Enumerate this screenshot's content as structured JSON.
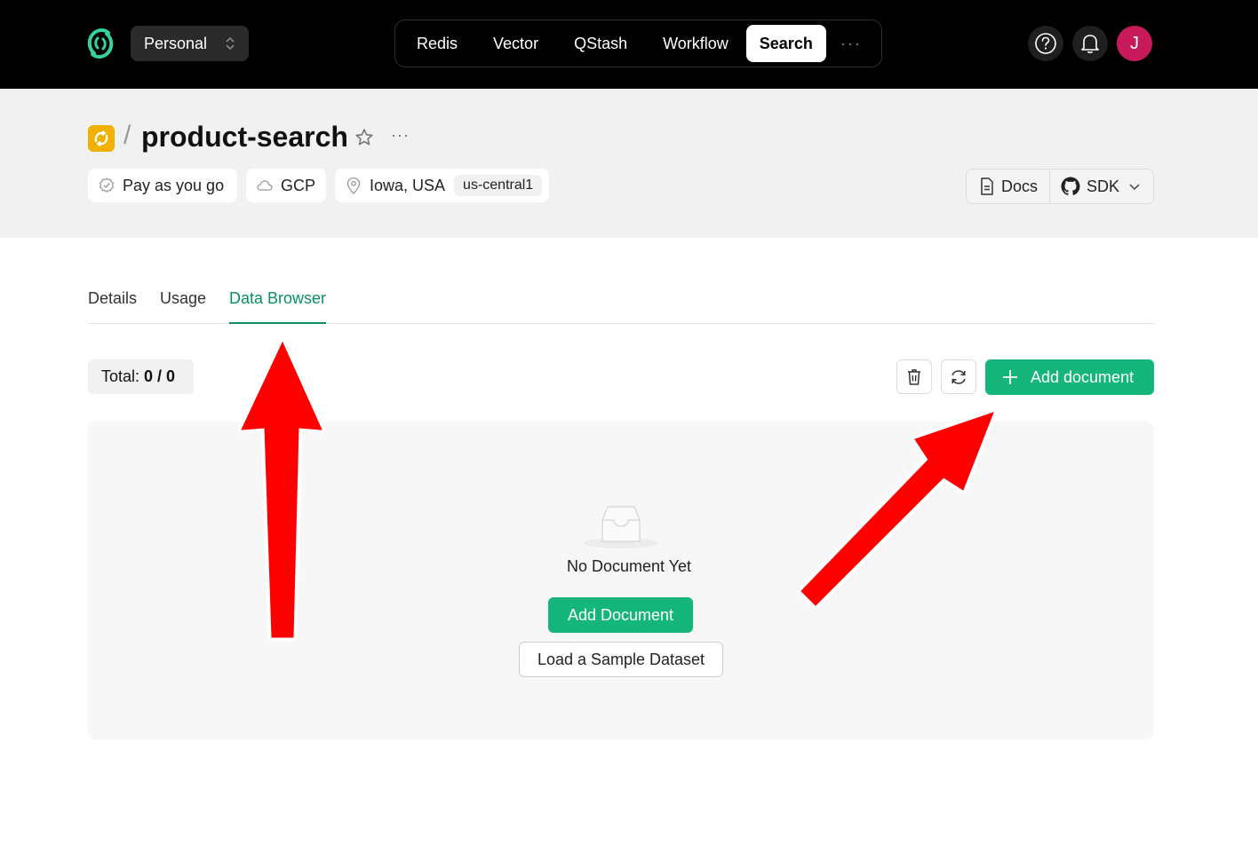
{
  "nav": {
    "team": "Personal",
    "products": [
      "Redis",
      "Vector",
      "QStash",
      "Workflow",
      "Search"
    ],
    "active_product": "Search",
    "more": "···",
    "avatar_initial": "J"
  },
  "header": {
    "separator": "/",
    "db_name": "product-search",
    "more": "···",
    "plan": "Pay as you go",
    "cloud": "GCP",
    "location": "Iowa, USA",
    "region": "us-central1",
    "docs_label": "Docs",
    "sdk_label": "SDK"
  },
  "tabs": [
    "Details",
    "Usage",
    "Data Browser"
  ],
  "active_tab": "Data Browser",
  "toolbar": {
    "total_label": "Total:",
    "total_value": "0 / 0",
    "add_label": "Add document"
  },
  "empty_state": {
    "message": "No Document Yet",
    "add_button": "Add Document",
    "sample_button": "Load a Sample Dataset"
  },
  "colors": {
    "accent": "#15b67c",
    "tab_active": "#0a8f63",
    "avatar": "#c8195a",
    "db_icon": "#f2b100",
    "annotation_arrow": "#ff0000"
  }
}
